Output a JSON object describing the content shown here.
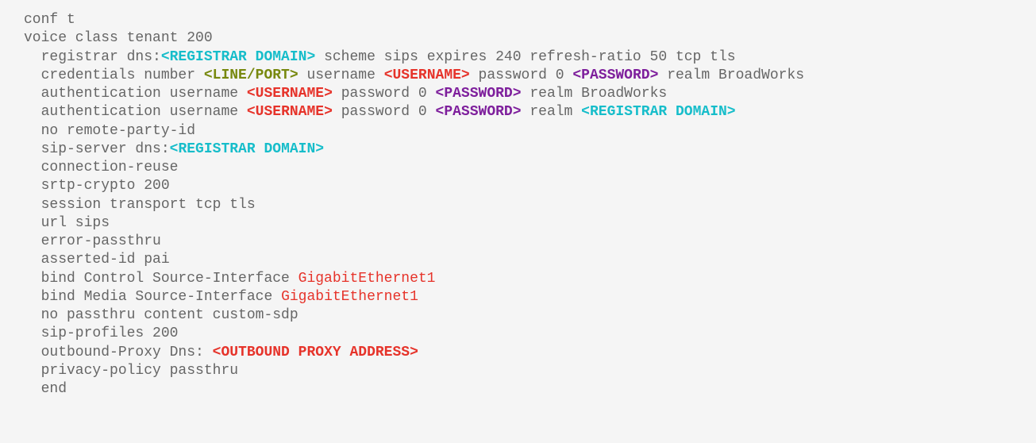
{
  "code": {
    "lines": [
      [
        {
          "t": "conf t"
        }
      ],
      [
        {
          "t": "voice class tenant 200"
        }
      ],
      [
        {
          "t": "  registrar dns:"
        },
        {
          "t": "<REGISTRAR DOMAIN>",
          "cls": "tok c-cyan"
        },
        {
          "t": " scheme sips expires 240 refresh-ratio 50 tcp tls"
        }
      ],
      [
        {
          "t": "  credentials number "
        },
        {
          "t": "<LINE/PORT>",
          "cls": "tok c-olive"
        },
        {
          "t": " username "
        },
        {
          "t": "<USERNAME>",
          "cls": "tok c-red"
        },
        {
          "t": " password 0 "
        },
        {
          "t": "<PASSWORD>",
          "cls": "tok c-purple"
        },
        {
          "t": " realm BroadWorks"
        }
      ],
      [
        {
          "t": "  authentication username "
        },
        {
          "t": "<USERNAME>",
          "cls": "tok c-red"
        },
        {
          "t": " password 0 "
        },
        {
          "t": "<PASSWORD>",
          "cls": "tok c-purple"
        },
        {
          "t": " realm BroadWorks"
        }
      ],
      [
        {
          "t": "  authentication username "
        },
        {
          "t": "<USERNAME>",
          "cls": "tok c-red"
        },
        {
          "t": " password 0 "
        },
        {
          "t": "<PASSWORD>",
          "cls": "tok c-purple"
        },
        {
          "t": " realm "
        },
        {
          "t": "<REGISTRAR DOMAIN>",
          "cls": "tok c-cyan"
        }
      ],
      [
        {
          "t": "  no remote-party-id"
        }
      ],
      [
        {
          "t": "  sip-server dns:"
        },
        {
          "t": "<REGISTRAR DOMAIN>",
          "cls": "tok c-cyan"
        }
      ],
      [
        {
          "t": "  connection-reuse"
        }
      ],
      [
        {
          "t": "  srtp-crypto 200"
        }
      ],
      [
        {
          "t": "  session transport tcp tls"
        }
      ],
      [
        {
          "t": "  url sips"
        }
      ],
      [
        {
          "t": "  error-passthru"
        }
      ],
      [
        {
          "t": "  asserted-id pai"
        }
      ],
      [
        {
          "t": "  bind Control Source-Interface "
        },
        {
          "t": "GigabitEthernet1",
          "cls": "c-red"
        }
      ],
      [
        {
          "t": "  bind Media Source-Interface "
        },
        {
          "t": "GigabitEthernet1",
          "cls": "c-red"
        }
      ],
      [
        {
          "t": "  no passthru content custom-sdp"
        }
      ],
      [
        {
          "t": "  sip-profiles 200"
        }
      ],
      [
        {
          "t": "  outbound-Proxy Dns: "
        },
        {
          "t": "<OUTBOUND PROXY ADDRESS>",
          "cls": "tok c-red"
        }
      ],
      [
        {
          "t": "  privacy-policy passthru"
        }
      ],
      [
        {
          "t": "  end"
        }
      ]
    ]
  }
}
